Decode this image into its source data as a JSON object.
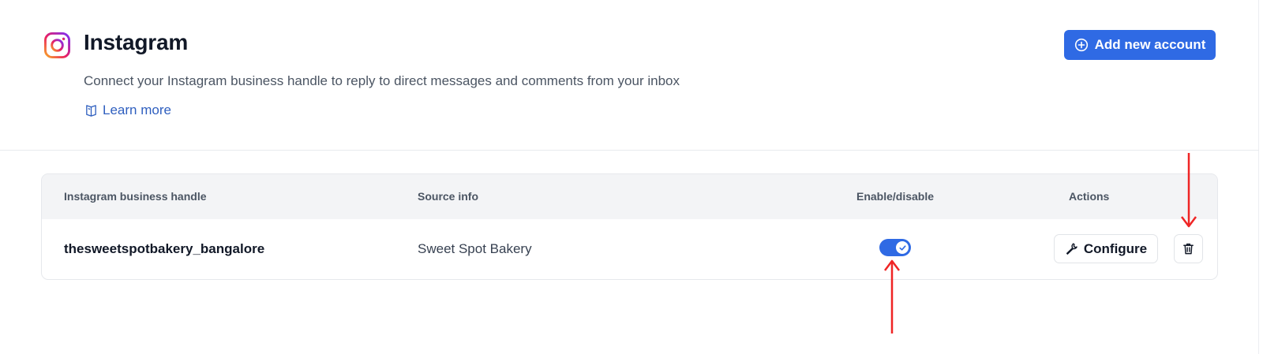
{
  "header": {
    "title": "Instagram",
    "description": "Connect your Instagram business handle to reply to direct messages and comments from your inbox",
    "learn_more": "Learn more",
    "add_button": "Add new account"
  },
  "table": {
    "columns": [
      "Instagram business handle",
      "Source info",
      "Enable/disable",
      "Actions"
    ],
    "rows": [
      {
        "handle": "thesweetspotbakery_bangalore",
        "source": "Sweet Spot Bakery",
        "enabled": true,
        "configure_label": "Configure"
      }
    ]
  },
  "icons": {
    "logo": "instagram-icon",
    "learn_more": "book-icon",
    "add": "plus-circle-icon",
    "toggle_check": "check-icon",
    "configure": "wrench-icon",
    "delete": "trash-icon"
  },
  "colors": {
    "accent": "#2f6ae4",
    "link": "#2f5fbf",
    "annotation_arrow": "#ef2525"
  }
}
